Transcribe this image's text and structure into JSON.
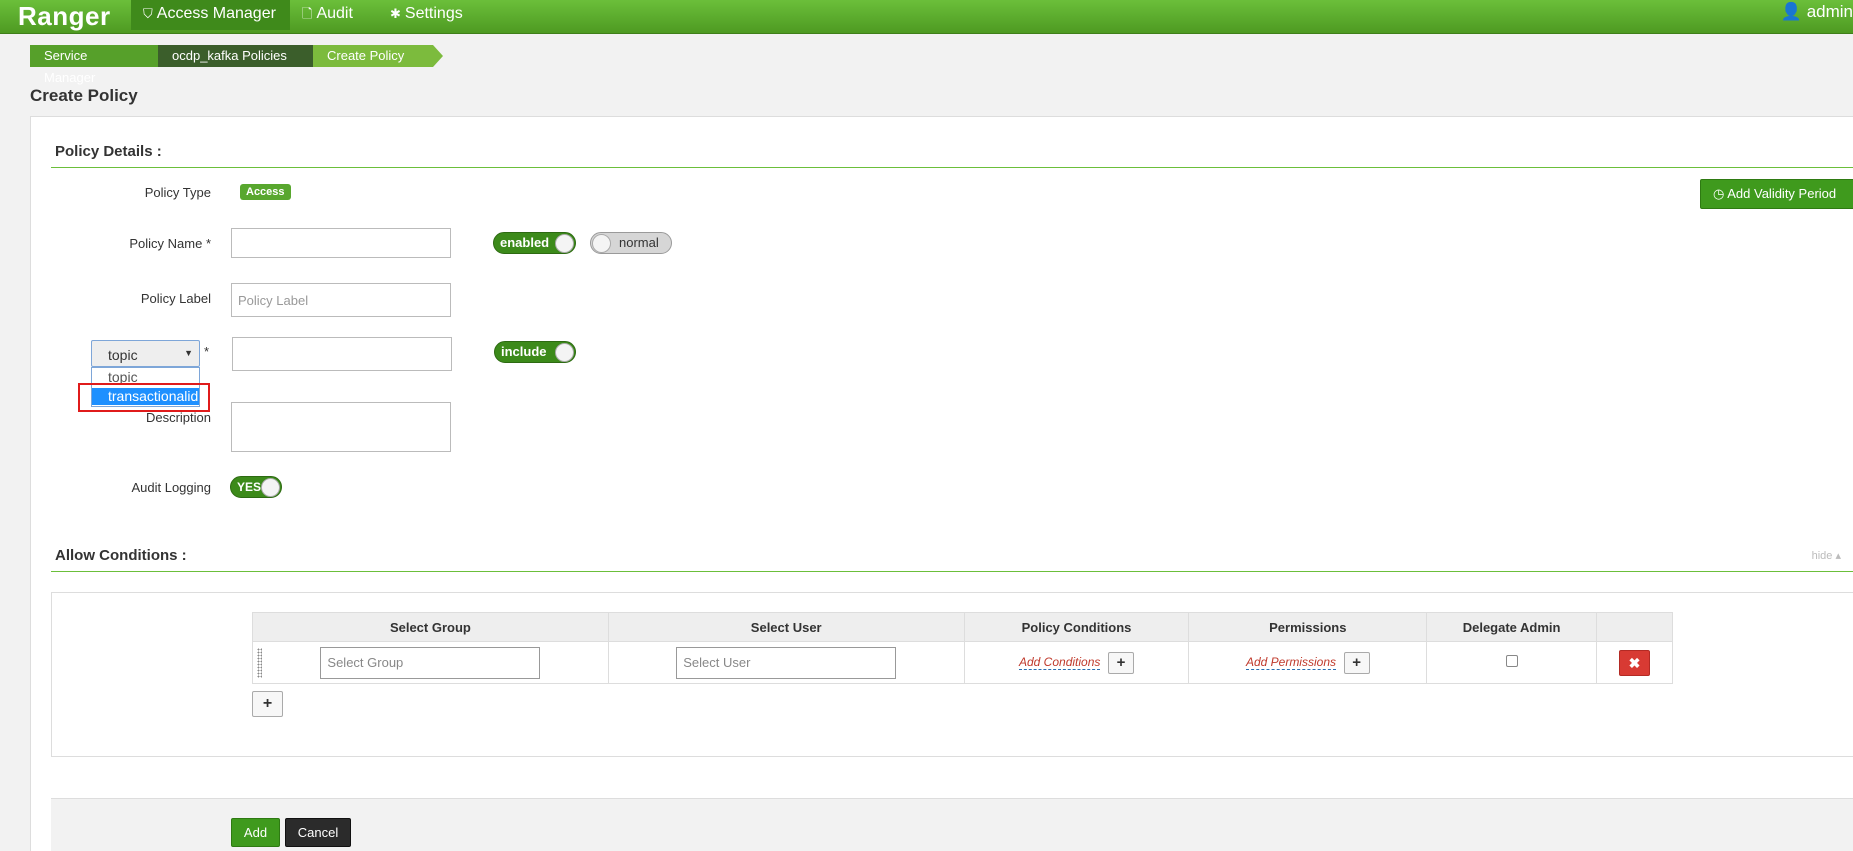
{
  "navbar": {
    "brand": "Ranger",
    "items": [
      {
        "label": "Access Manager",
        "icon": "shield-icon"
      },
      {
        "label": "Audit",
        "icon": "file-icon"
      },
      {
        "label": "Settings",
        "icon": "gear-icon"
      }
    ],
    "user": "admin"
  },
  "breadcrumb": [
    "Service Manager",
    "ocdp_kafka Policies",
    "Create Policy"
  ],
  "page_title": "Create Policy",
  "policy_details": {
    "title": "Policy Details :",
    "policy_type_label": "Policy Type",
    "policy_type_value": "Access",
    "add_validity_label": "Add Validity Period",
    "policy_name_label": "Policy Name *",
    "policy_name_value": "",
    "enabled_toggle": "enabled",
    "normal_toggle": "normal",
    "policy_label_label": "Policy Label",
    "policy_label_placeholder": "Policy Label",
    "resource_select": {
      "selected": "topic",
      "options": [
        "topic",
        "transactionalid"
      ],
      "highlighted": "transactionalid"
    },
    "resource_required": "*",
    "resource_value": "",
    "include_toggle": "include",
    "description_label": "Description",
    "audit_logging_label": "Audit Logging",
    "audit_logging_value": "YES"
  },
  "allow_conditions": {
    "title": "Allow Conditions :",
    "hide_label": "hide ▴",
    "columns": [
      "Select Group",
      "Select User",
      "Policy Conditions",
      "Permissions",
      "Delegate Admin"
    ],
    "row": {
      "group_placeholder": "Select Group",
      "user_placeholder": "Select User",
      "conditions_link": "Add Conditions",
      "permissions_link": "Add Permissions"
    }
  },
  "footer": {
    "add_label": "Add",
    "cancel_label": "Cancel"
  },
  "colors": {
    "brand_green": "#4e9a22",
    "button_green": "#3f9a1d",
    "danger": "#d83a33",
    "highlight_red": "#e01b1b",
    "select_blue": "#1e90ff"
  }
}
